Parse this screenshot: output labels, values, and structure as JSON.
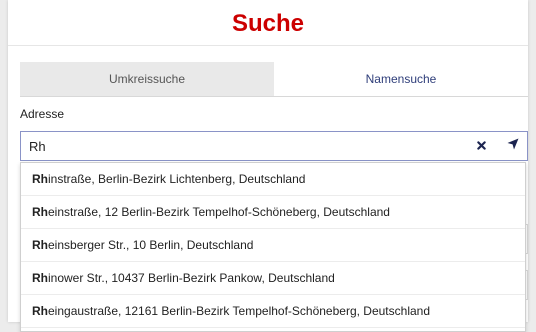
{
  "title": "Suche",
  "tabs": [
    {
      "label": "Umkreissuche",
      "active": false
    },
    {
      "label": "Namensuche",
      "active": true
    }
  ],
  "address": {
    "label": "Adresse",
    "value": "Rh",
    "clear_icon": "close-icon",
    "locate_icon": "location-arrow-icon"
  },
  "suggestions": [
    {
      "match": "Rh",
      "rest": "instraße, Berlin-Bezirk Lichtenberg, Deutschland"
    },
    {
      "match": "Rh",
      "rest": "einstraße, 12 Berlin-Bezirk Tempelhof-Schöneberg, Deutschland"
    },
    {
      "match": "Rh",
      "rest": "einsberger Str., 10 Berlin, Deutschland"
    },
    {
      "match": "Rh",
      "rest": "inower Str., 10437 Berlin-Bezirk Pankow, Deutschland"
    },
    {
      "match": "Rh",
      "rest": "eingaustraße, 12161 Berlin-Bezirk Tempelhof-Schöneberg, Deutschland"
    }
  ],
  "colors": {
    "title": "#cc0000",
    "tab_active_text": "#2f3e7a",
    "input_border": "#8a93c7",
    "icon": "#1c2550"
  }
}
